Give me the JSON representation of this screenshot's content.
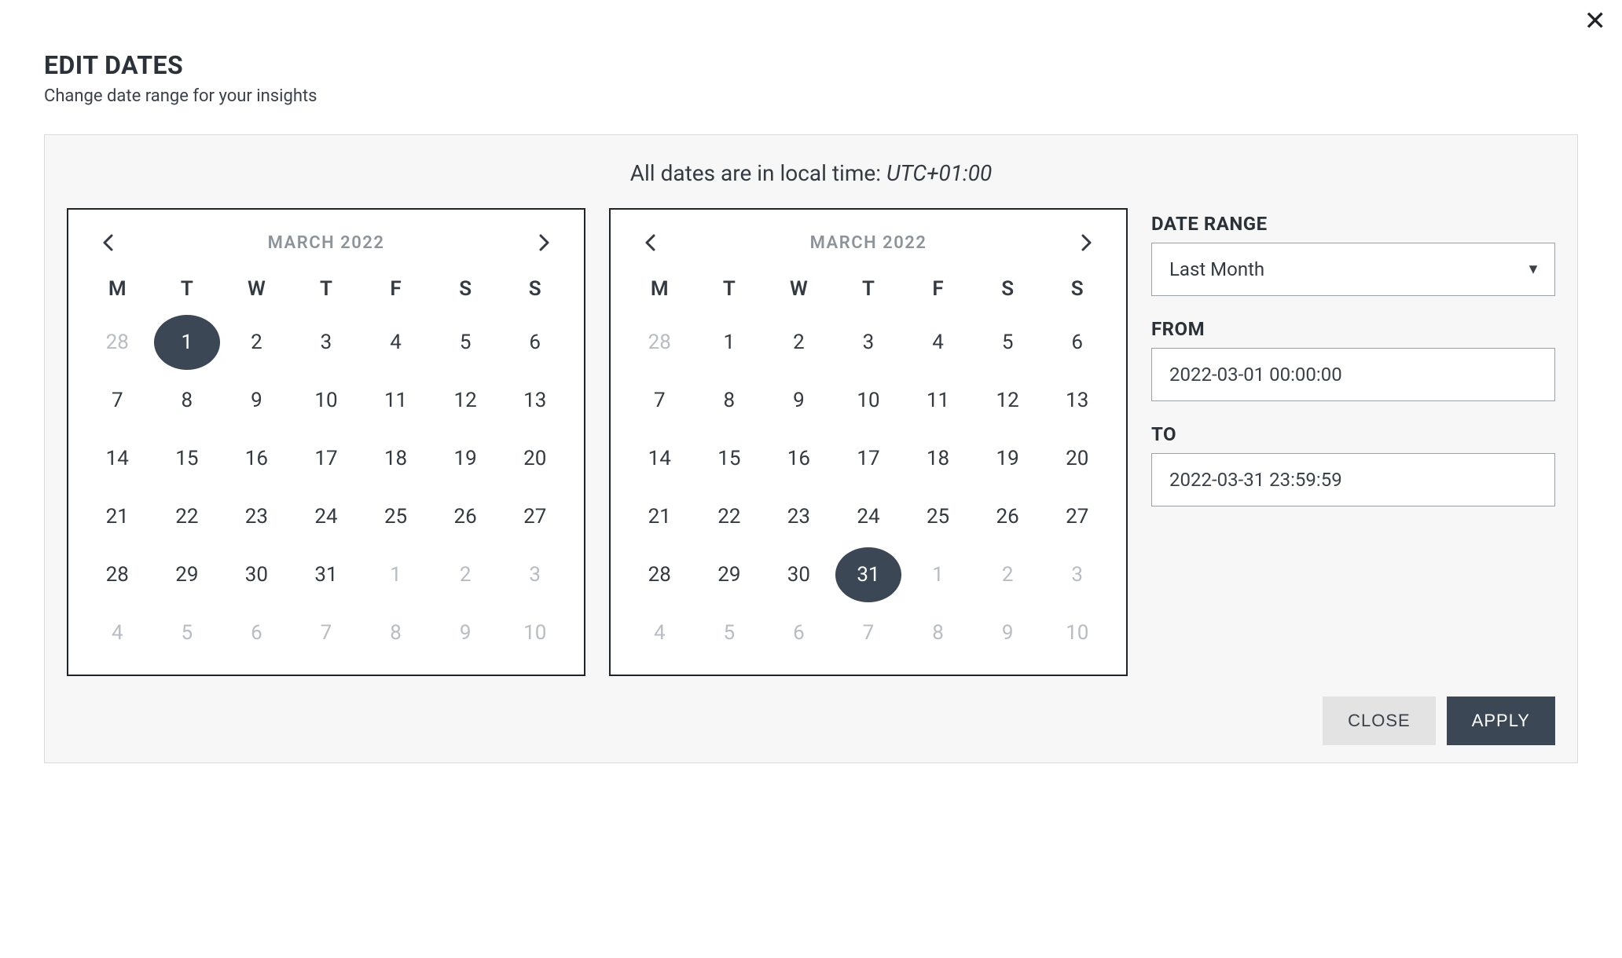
{
  "dialog_title": "EDIT DATES",
  "dialog_subtitle": "Change date range for your insights",
  "timezone_prefix": "All dates are in local time: ",
  "timezone_value": "UTC+01:00",
  "weekdays": [
    "M",
    "T",
    "W",
    "T",
    "F",
    "S",
    "S"
  ],
  "calendar_left": {
    "month_label": "MARCH 2022",
    "selected_day_index": 1,
    "days": [
      {
        "n": "28",
        "muted": true
      },
      {
        "n": "1"
      },
      {
        "n": "2"
      },
      {
        "n": "3"
      },
      {
        "n": "4"
      },
      {
        "n": "5"
      },
      {
        "n": "6"
      },
      {
        "n": "7"
      },
      {
        "n": "8"
      },
      {
        "n": "9"
      },
      {
        "n": "10"
      },
      {
        "n": "11"
      },
      {
        "n": "12"
      },
      {
        "n": "13"
      },
      {
        "n": "14"
      },
      {
        "n": "15"
      },
      {
        "n": "16"
      },
      {
        "n": "17"
      },
      {
        "n": "18"
      },
      {
        "n": "19"
      },
      {
        "n": "20"
      },
      {
        "n": "21"
      },
      {
        "n": "22"
      },
      {
        "n": "23"
      },
      {
        "n": "24"
      },
      {
        "n": "25"
      },
      {
        "n": "26"
      },
      {
        "n": "27"
      },
      {
        "n": "28"
      },
      {
        "n": "29"
      },
      {
        "n": "30"
      },
      {
        "n": "31"
      },
      {
        "n": "1",
        "muted": true
      },
      {
        "n": "2",
        "muted": true
      },
      {
        "n": "3",
        "muted": true
      },
      {
        "n": "4",
        "muted": true
      },
      {
        "n": "5",
        "muted": true
      },
      {
        "n": "6",
        "muted": true
      },
      {
        "n": "7",
        "muted": true
      },
      {
        "n": "8",
        "muted": true
      },
      {
        "n": "9",
        "muted": true
      },
      {
        "n": "10",
        "muted": true
      }
    ]
  },
  "calendar_right": {
    "month_label": "MARCH 2022",
    "selected_day_index": 31,
    "days": [
      {
        "n": "28",
        "muted": true
      },
      {
        "n": "1"
      },
      {
        "n": "2"
      },
      {
        "n": "3"
      },
      {
        "n": "4"
      },
      {
        "n": "5"
      },
      {
        "n": "6"
      },
      {
        "n": "7"
      },
      {
        "n": "8"
      },
      {
        "n": "9"
      },
      {
        "n": "10"
      },
      {
        "n": "11"
      },
      {
        "n": "12"
      },
      {
        "n": "13"
      },
      {
        "n": "14"
      },
      {
        "n": "15"
      },
      {
        "n": "16"
      },
      {
        "n": "17"
      },
      {
        "n": "18"
      },
      {
        "n": "19"
      },
      {
        "n": "20"
      },
      {
        "n": "21"
      },
      {
        "n": "22"
      },
      {
        "n": "23"
      },
      {
        "n": "24"
      },
      {
        "n": "25"
      },
      {
        "n": "26"
      },
      {
        "n": "27"
      },
      {
        "n": "28"
      },
      {
        "n": "29"
      },
      {
        "n": "30"
      },
      {
        "n": "31"
      },
      {
        "n": "1",
        "muted": true
      },
      {
        "n": "2",
        "muted": true
      },
      {
        "n": "3",
        "muted": true
      },
      {
        "n": "4",
        "muted": true
      },
      {
        "n": "5",
        "muted": true
      },
      {
        "n": "6",
        "muted": true
      },
      {
        "n": "7",
        "muted": true
      },
      {
        "n": "8",
        "muted": true
      },
      {
        "n": "9",
        "muted": true
      },
      {
        "n": "10",
        "muted": true
      }
    ]
  },
  "side": {
    "range_label": "DATE RANGE",
    "range_value": "Last Month",
    "from_label": "FROM",
    "from_value": "2022-03-01 00:00:00",
    "to_label": "TO",
    "to_value": "2022-03-31 23:59:59"
  },
  "buttons": {
    "close": "CLOSE",
    "apply": "APPLY"
  }
}
